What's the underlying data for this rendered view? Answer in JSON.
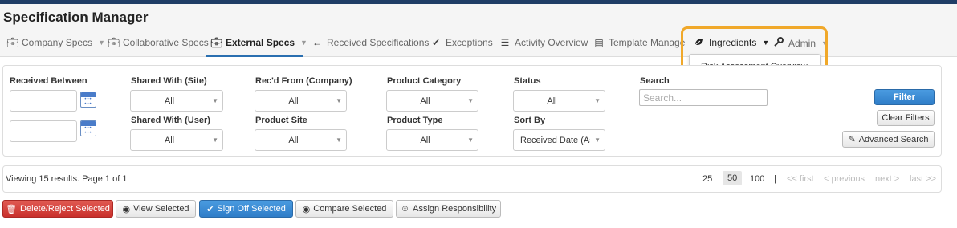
{
  "app": {
    "title": "Specification Manager"
  },
  "nav": {
    "items": [
      {
        "label": "Company Specs",
        "icon": "briefcase-icon",
        "caret": true
      },
      {
        "label": "Collaborative Specs",
        "icon": "briefcase-icon",
        "caret": false
      },
      {
        "label": "External Specs",
        "icon": "briefcase-icon",
        "caret": true,
        "active": true
      },
      {
        "label": "Received Specifications",
        "icon": "arrow-left-icon",
        "caret": false
      },
      {
        "label": "Exceptions",
        "icon": "check-circle-icon",
        "caret": false
      },
      {
        "label": "Activity Overview",
        "icon": "list-icon",
        "caret": false
      },
      {
        "label": "Template Manage",
        "icon": "table-icon",
        "caret": false
      },
      {
        "label": "Ingredients",
        "icon": "leaf-icon",
        "caret": true
      },
      {
        "label": "Admin",
        "icon": "wrench-icon",
        "caret": true
      }
    ],
    "dropdown_item": "Risk Assessment Overview"
  },
  "filters": {
    "received_between": "Received Between",
    "shared_site": {
      "label": "Shared With (Site)",
      "value": "All"
    },
    "shared_user": {
      "label": "Shared With (User)",
      "value": "All"
    },
    "recd_from": {
      "label": "Rec'd From (Company)",
      "value": "All"
    },
    "product_site": {
      "label": "Product Site",
      "value": "All"
    },
    "product_category": {
      "label": "Product Category",
      "value": "All"
    },
    "product_type": {
      "label": "Product Type",
      "value": "All"
    },
    "status": {
      "label": "Status",
      "value": "All"
    },
    "sort_by": {
      "label": "Sort By",
      "value": "Received Date (Asc"
    },
    "search": {
      "label": "Search",
      "placeholder": "Search..."
    },
    "buttons": {
      "filter": "Filter",
      "clear": "Clear Filters",
      "advanced": "Advanced Search"
    }
  },
  "results": {
    "summary": "Viewing 15 results. Page 1 of 1",
    "page_sizes": [
      "25",
      "50",
      "100"
    ],
    "current_size": "50",
    "separator": "|",
    "first": "<< first",
    "previous": "< previous",
    "next": "next >",
    "last": "last >>"
  },
  "actions": {
    "delete": "Delete/Reject Selected",
    "view": "View Selected",
    "signoff": "Sign Off Selected",
    "compare": "Compare Selected",
    "assign": "Assign Responsibility"
  },
  "colors": {
    "accent": "#2f7dc8",
    "danger": "#c9302c",
    "highlight": "#f0a82a",
    "topbar": "#1f3d66"
  }
}
